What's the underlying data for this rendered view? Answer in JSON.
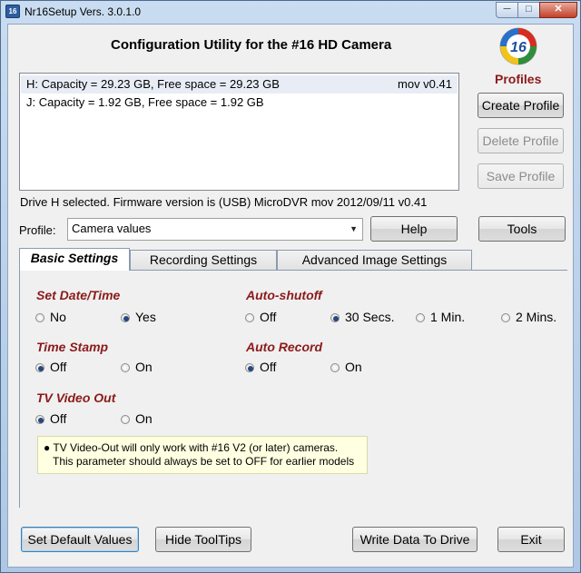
{
  "window": {
    "title": "Nr16Setup  Vers. 3.0.1.0",
    "app_icon_text": "16",
    "min_symbol": "─",
    "max_symbol": "□",
    "close_symbol": "✕"
  },
  "header": {
    "heading": "Configuration Utility for the #16 HD Camera",
    "logo_text": "16",
    "profiles_label": "Profiles"
  },
  "drives": [
    {
      "info": "H:  Capacity = 29.23 GB, Free space = 29.23 GB",
      "firmware": "mov v0.41"
    },
    {
      "info": "J:  Capacity = 1.92 GB, Free space = 1.92 GB",
      "firmware": ""
    }
  ],
  "profile_buttons": {
    "create": "Create Profile",
    "delete": "Delete Profile",
    "save": "Save Profile"
  },
  "status": "Drive H selected. Firmware version is (USB) MicroDVR mov 2012/09/11 v0.41",
  "profile": {
    "label": "Profile:",
    "selected": "Camera values",
    "help": "Help",
    "tools": "Tools"
  },
  "tabs": [
    "Basic Settings",
    "Recording Settings",
    "Advanced Image Settings"
  ],
  "settings": {
    "date_time": {
      "title": "Set Date/Time",
      "options": [
        "No",
        "Yes"
      ],
      "selected": "Yes"
    },
    "auto_shutoff": {
      "title": "Auto-shutoff",
      "options": [
        "Off",
        "30 Secs.",
        "1 Min.",
        "2 Mins."
      ],
      "selected": "30 Secs."
    },
    "time_stamp": {
      "title": "Time Stamp",
      "options": [
        "Off",
        "On"
      ],
      "selected": "Off"
    },
    "auto_record": {
      "title": "Auto Record",
      "options": [
        "Off",
        "On"
      ],
      "selected": "Off"
    },
    "tv_out": {
      "title": "TV Video Out",
      "options": [
        "Off",
        "On"
      ],
      "selected": "Off"
    }
  },
  "tooltip": {
    "line1": "● TV Video-Out will only work with #16 V2 (or later) cameras.",
    "line2": "This parameter should always be set to OFF for earlier models"
  },
  "bottom": {
    "defaults": "Set Default Values",
    "tooltips": "Hide ToolTips",
    "write": "Write Data To Drive",
    "exit": "Exit"
  },
  "colors": {
    "section_title": "#8b1a1a",
    "tooltip_bg": "#ffffe1",
    "window_frame": "#bfd3ea"
  }
}
